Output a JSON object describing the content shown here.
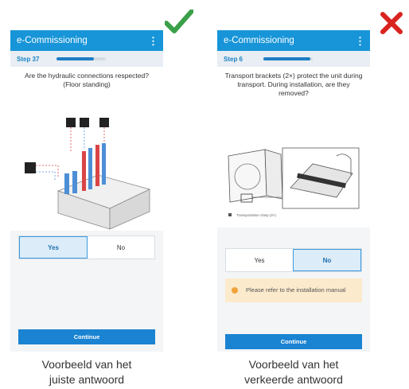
{
  "left": {
    "app_title": "e-Commissioning",
    "step_label": "Step 37",
    "progress": 0.75,
    "question": "Are the hydraulic connections respected? (Floor standing)",
    "answers": [
      "Yes",
      "No"
    ],
    "selected": "Yes",
    "continue_label": "Continue",
    "caption_line1": "Voorbeeld van het",
    "caption_line2": "juiste antwoord",
    "verdict_icon": "check-icon",
    "verdict_color": "#3aa049"
  },
  "right": {
    "app_title": "e-Commissioning",
    "step_label": "Step 6",
    "progress": 0.95,
    "question": "Transport brackets (2×) protect the unit during transport. During installation, are they removed?",
    "illustration_caption": "Transportation clasp (2×)",
    "answers": [
      "Yes",
      "No"
    ],
    "selected": "No",
    "info_text": "Please refer to the installation manual",
    "continue_label": "Continue",
    "caption_line1": "Voorbeeld van het",
    "caption_line2": "verkeerde antwoord",
    "verdict_icon": "cross-icon",
    "verdict_color": "#d9231f"
  },
  "colors": {
    "accent": "#1795d8",
    "selected_bg": "#dcecf8",
    "info_bg": "#fbeacc"
  }
}
